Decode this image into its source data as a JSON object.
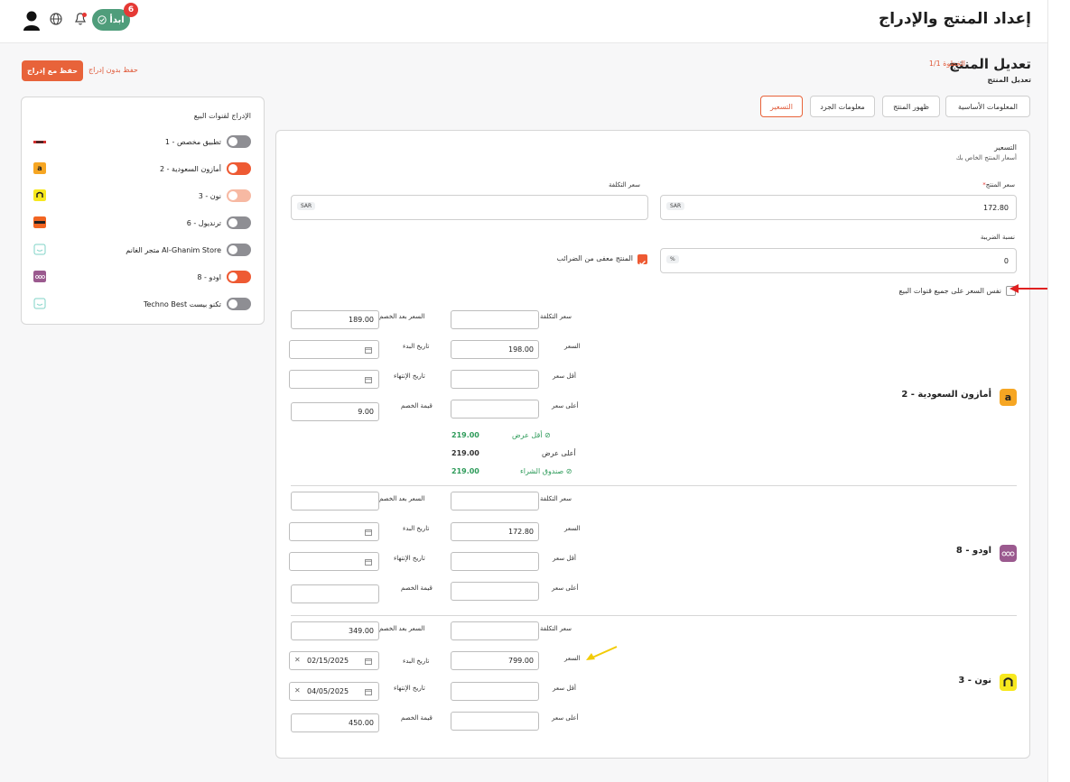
{
  "header": {
    "page_title": "إعداد المنتج والإدراج",
    "start_label": "ابدأ",
    "start_badge": "6",
    "icons": [
      "user-icon",
      "globe-icon",
      "bell-icon",
      "check-circle-icon"
    ]
  },
  "page": {
    "title": "تعديل المنتج",
    "step": "الخطوة 1/1",
    "subtitle": "تعديل المنتج",
    "save_button": "حفظ مع إدراج",
    "save_without_listing": "حفظ بدون إدراج"
  },
  "tabs": [
    {
      "label": "المعلومات الأساسية",
      "active": false
    },
    {
      "label": "ظهور المنتج",
      "active": false
    },
    {
      "label": "معلومات الجرد",
      "active": false
    },
    {
      "label": "التسعير",
      "active": true
    }
  ],
  "channels_panel": {
    "title": "الإدراج لقنوات البيع",
    "items": [
      {
        "label": "تطبيق مخصص - 1",
        "state": "off",
        "logo": "custom-app-logo"
      },
      {
        "label": "أمازون السعودية - 2",
        "state": "on",
        "logo": "amazon-logo"
      },
      {
        "label": "نون - 3",
        "state": "pending",
        "logo": "noon-logo"
      },
      {
        "label": "ترنديول - 6",
        "state": "off",
        "logo": "trendyol-logo"
      },
      {
        "label": "Al-Ghanim Store متجر الغانم",
        "state": "off",
        "logo": "store-logo"
      },
      {
        "label": "اودو - 8",
        "state": "on",
        "logo": "odoo-logo"
      },
      {
        "label": "تكنو بيست Techno Best",
        "state": "off",
        "logo": "store-logo"
      }
    ]
  },
  "pricing": {
    "section_title": "التسعير",
    "section_subtitle": "أسعار المنتج الخاص بك",
    "product_price_label": "سعر المنتج",
    "required_mark": "*",
    "product_price_value": "172.80",
    "currency": "SAR",
    "cost_price_label": "سعر التكلفة",
    "cost_price_value": "",
    "tax_label": "نسبة الضريبة",
    "tax_value": "0",
    "tax_unit": "%",
    "tax_exempt_label": "المنتج معفى من الضرائب",
    "tax_exempt_checked": true,
    "same_price_label": "نفس السعر على جميع قنوات البيع",
    "same_price_checked": false
  },
  "field_labels": {
    "cost": "سعر التكلفة",
    "price": "السعر",
    "min_price": "أقل سعر",
    "max_price": "أعلى سعر",
    "discounted_price": "السعر بعد الخصم",
    "start_date": "تاريخ البدء",
    "end_date": "تاريخ الإنتهاء",
    "discount_value": "قيمة الخصم"
  },
  "channel_prices": [
    {
      "name": "أمازون السعودية - 2",
      "cost": "",
      "price": "198.00",
      "min_price": "",
      "max_price": "",
      "discounted_price": "189.00",
      "start_date": "",
      "end_date": "",
      "discount_value": "9.00",
      "offers": [
        {
          "label": "أقل عرض",
          "value": "219.00",
          "highlight": true
        },
        {
          "label": "أعلى عرض",
          "value": "219.00",
          "highlight": false
        },
        {
          "label": "صندوق الشراء",
          "value": "219.00",
          "highlight": true
        }
      ]
    },
    {
      "name": "اودو - 8",
      "cost": "",
      "price": "172.80",
      "min_price": "",
      "max_price": "",
      "discounted_price": "",
      "start_date": "",
      "end_date": "",
      "discount_value": ""
    },
    {
      "name": "نون - 3",
      "cost": "",
      "price": "799.00",
      "min_price": "",
      "max_price": "",
      "discounted_price": "349.00",
      "start_date": "02/15/2025",
      "end_date": "04/05/2025",
      "discount_value": "450.00"
    }
  ],
  "colors": {
    "accent": "#ee5a33",
    "start_button": "#4f9d7b",
    "badge": "#e53935",
    "offer_green": "#2e9b5a",
    "amazon": "#f6a623",
    "noon": "#f7e81e",
    "odoo": "#9b5a8f",
    "annotation_red": "#e02020",
    "annotation_yellow": "#f2cb05"
  }
}
